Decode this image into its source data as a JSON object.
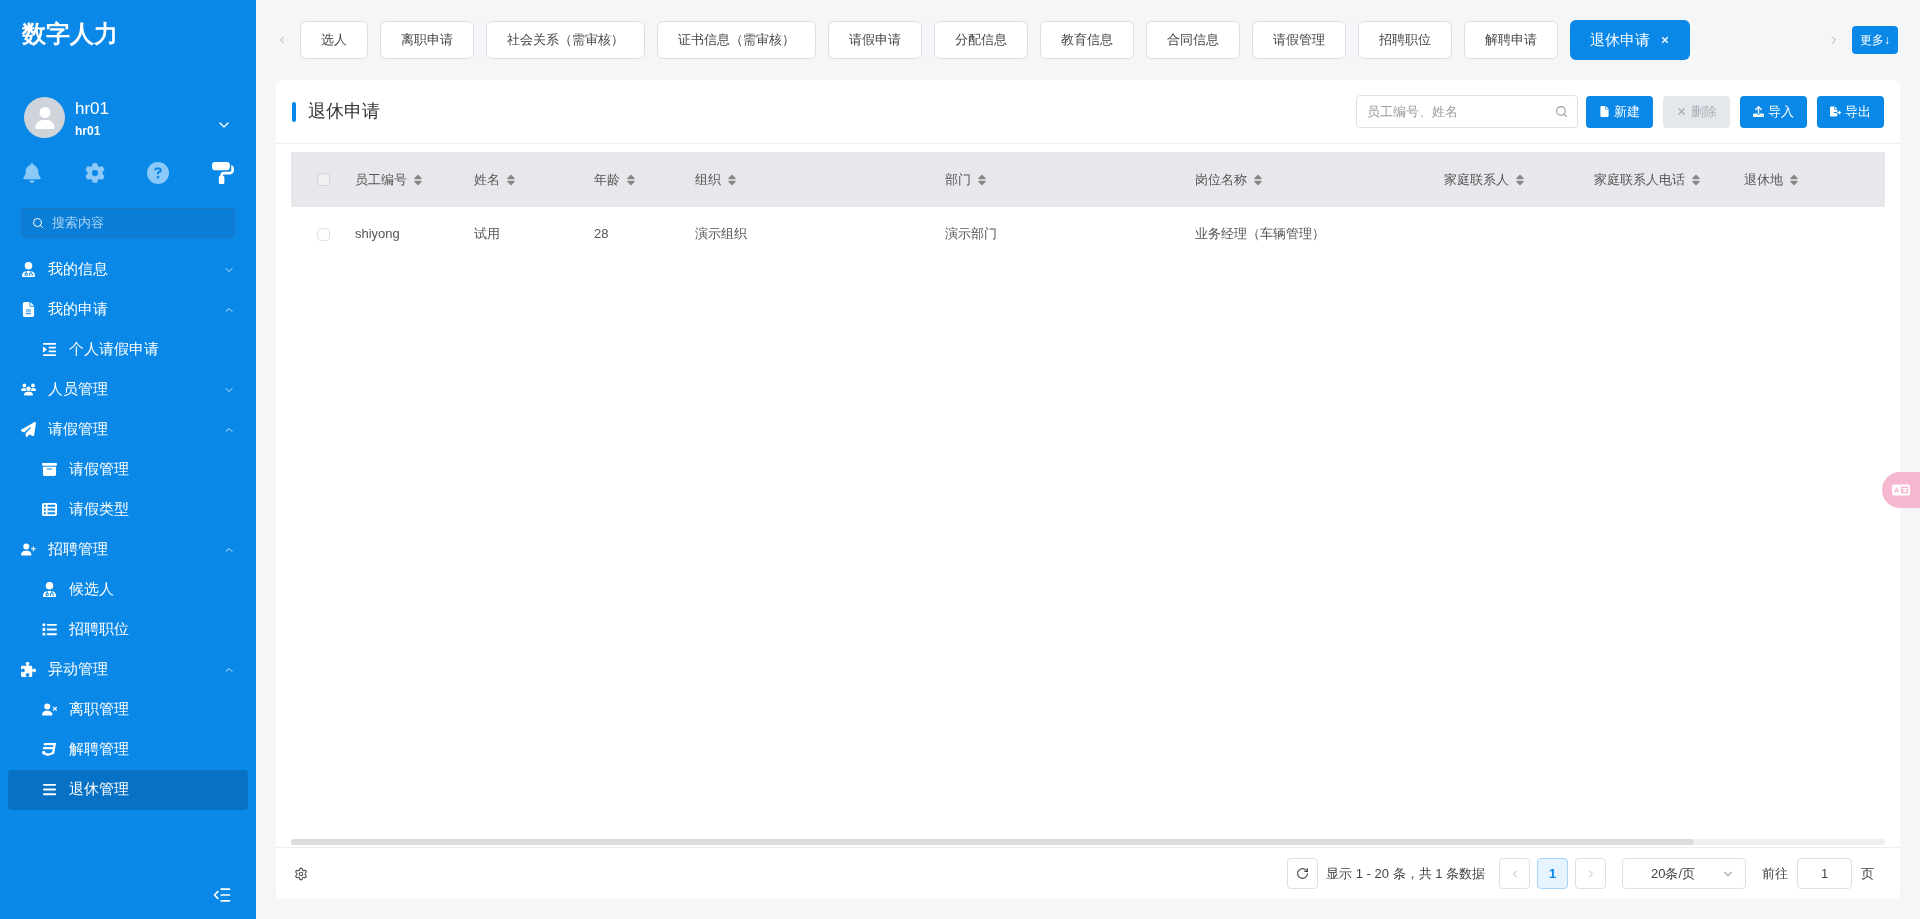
{
  "app": {
    "title": "数字人力"
  },
  "user": {
    "name": "hr01",
    "account": "hr01"
  },
  "sidebar": {
    "search_placeholder": "搜索内容",
    "items": [
      {
        "label": "我的信息",
        "expanded": false,
        "selected": false
      },
      {
        "label": "我的申请",
        "expanded": true,
        "selected": false,
        "children": [
          {
            "label": "个人请假申请",
            "selected": false
          }
        ]
      },
      {
        "label": "人员管理",
        "expanded": false,
        "selected": false
      },
      {
        "label": "请假管理",
        "expanded": true,
        "selected": false,
        "children": [
          {
            "label": "请假管理",
            "selected": false
          },
          {
            "label": "请假类型",
            "selected": false
          }
        ]
      },
      {
        "label": "招聘管理",
        "expanded": true,
        "selected": false,
        "children": [
          {
            "label": "候选人",
            "selected": false
          },
          {
            "label": "招聘职位",
            "selected": false
          }
        ]
      },
      {
        "label": "异动管理",
        "expanded": true,
        "selected": false,
        "children": [
          {
            "label": "离职管理",
            "selected": false
          },
          {
            "label": "解聘管理",
            "selected": false
          },
          {
            "label": "退休管理",
            "selected": true
          }
        ]
      }
    ]
  },
  "tabs": [
    {
      "label": "选人",
      "selected": false,
      "closable": false
    },
    {
      "label": "离职申请",
      "selected": false,
      "closable": false
    },
    {
      "label": "社会关系（需审核）",
      "selected": false,
      "closable": false
    },
    {
      "label": "证书信息（需审核）",
      "selected": false,
      "closable": false
    },
    {
      "label": "请假申请",
      "selected": false,
      "closable": false
    },
    {
      "label": "分配信息",
      "selected": false,
      "closable": false
    },
    {
      "label": "教育信息",
      "selected": false,
      "closable": false
    },
    {
      "label": "合同信息",
      "selected": false,
      "closable": false
    },
    {
      "label": "请假管理",
      "selected": false,
      "closable": false
    },
    {
      "label": "招聘职位",
      "selected": false,
      "closable": false
    },
    {
      "label": "解聘申请",
      "selected": false,
      "closable": false
    },
    {
      "label": "退休申请",
      "selected": true,
      "closable": true
    }
  ],
  "more_button": "更多↓",
  "panel": {
    "title": "退休申请",
    "search_placeholder": "员工编号、姓名",
    "actions": [
      {
        "label": "新建",
        "disabled": false
      },
      {
        "label": "删除",
        "disabled": true
      },
      {
        "label": "导入",
        "disabled": false
      },
      {
        "label": "导出",
        "disabled": false
      }
    ]
  },
  "table": {
    "all_checked": false,
    "columns": [
      "员工编号",
      "姓名",
      "年龄",
      "组织",
      "部门",
      "岗位名称",
      "家庭联系人",
      "家庭联系人电话",
      "退休地"
    ],
    "rows": [
      {
        "checked": false,
        "cells": [
          "shiyong",
          "试用",
          "28",
          "演示组织",
          "演示部门",
          "业务经理（车辆管理）",
          "",
          "",
          ""
        ]
      }
    ]
  },
  "pagination": {
    "summary": "显示 1 - 20 条，共 1 条数据",
    "pages": [
      {
        "label": "1",
        "selected": true
      }
    ],
    "page_size": "20条/页",
    "goto_label": "前往",
    "goto_value": "1",
    "page_unit": "页"
  }
}
